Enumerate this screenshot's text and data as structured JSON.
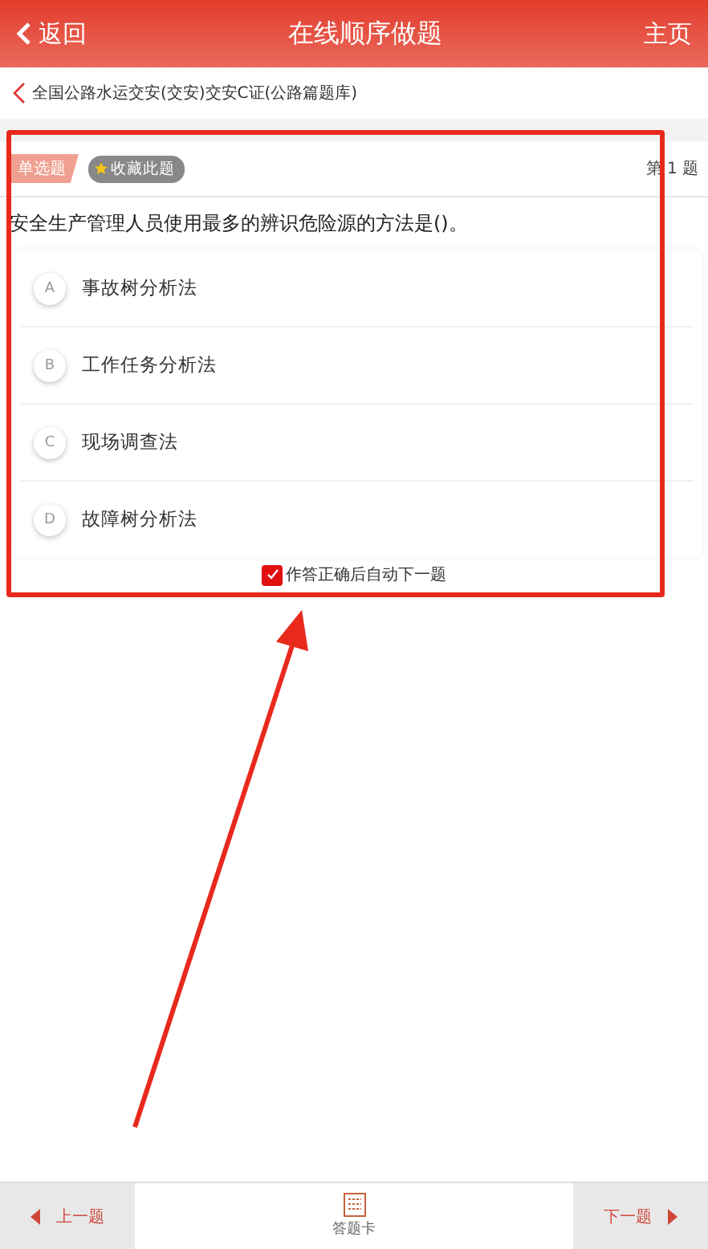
{
  "header": {
    "back": "返回",
    "title": "在线顺序做题",
    "home": "主页"
  },
  "breadcrumb": "全国公路水运交安(交安)交安C证(公路篇题库)",
  "question": {
    "type_tag": "单选题",
    "favorite": "收藏此题",
    "number": "第 1 题",
    "text": "安全生产管理人员使用最多的辨识危险源的方法是()。",
    "options": [
      {
        "letter": "A",
        "text": "事故树分析法",
        "selected": false
      },
      {
        "letter": "B",
        "text": "工作任务分析法",
        "selected": false
      },
      {
        "letter": "C",
        "text": "现场调查法",
        "selected": false
      },
      {
        "letter": "D",
        "text": "故障树分析法",
        "selected": false
      }
    ]
  },
  "auto_next": {
    "label": "作答正确后自动下一题",
    "checked": true
  },
  "footer": {
    "prev": "上一题",
    "card": "答题卡",
    "next": "下一题"
  }
}
